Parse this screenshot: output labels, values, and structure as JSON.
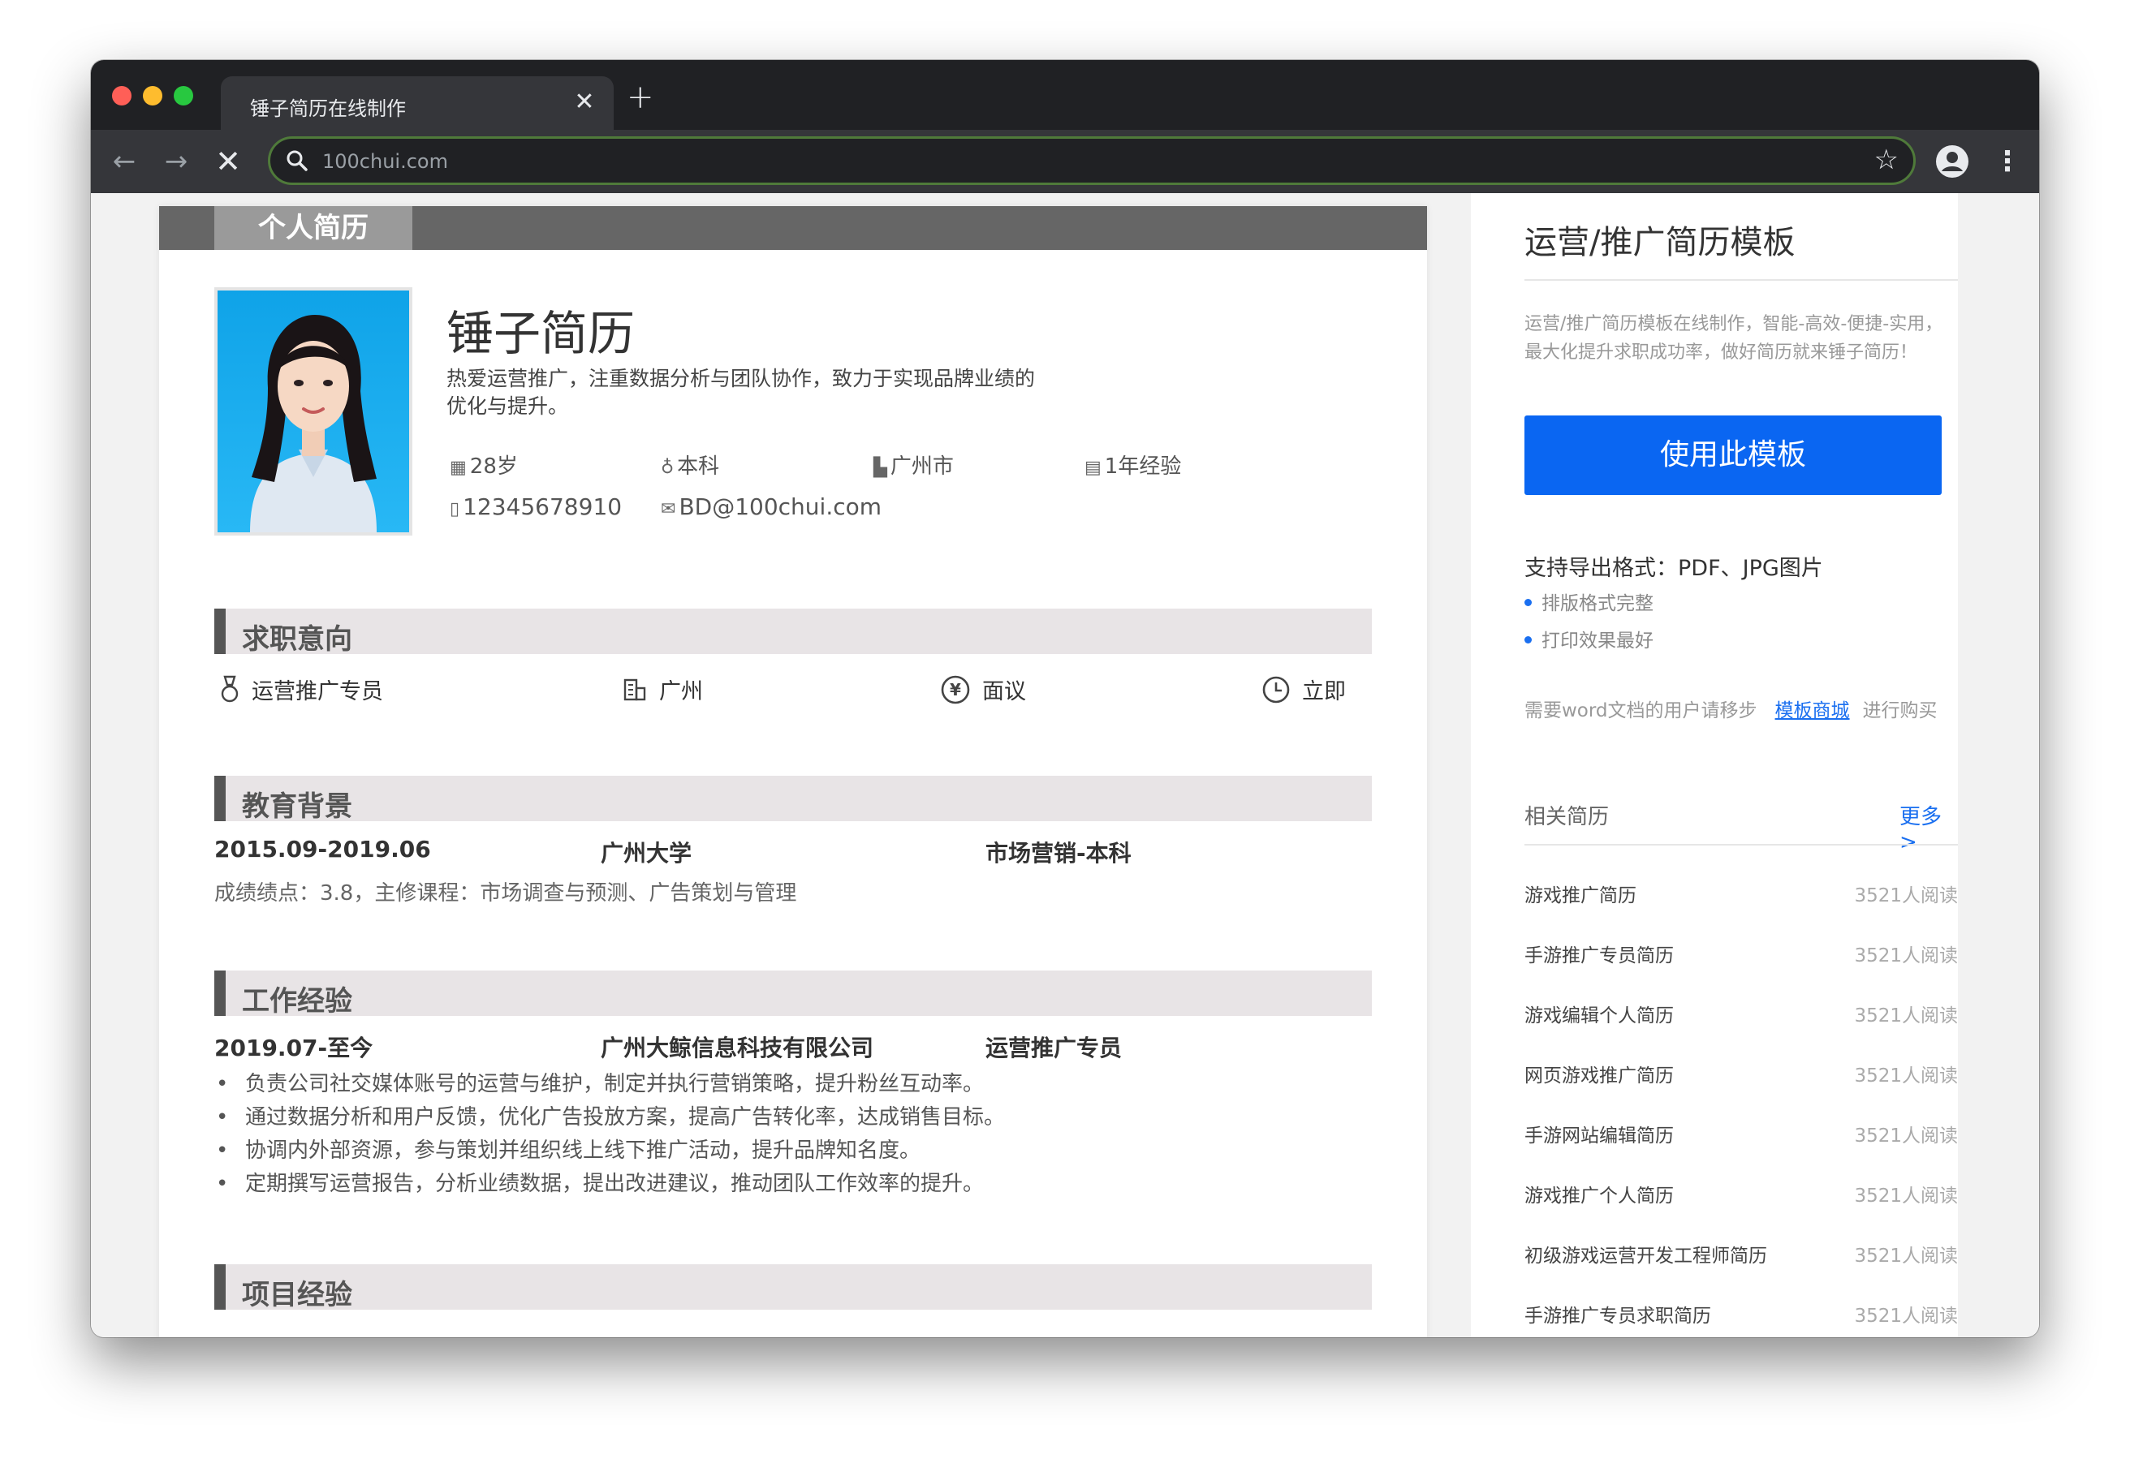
{
  "browser": {
    "tab_title": "锤子简历在线制作",
    "tab_close": "✕",
    "new_tab": "+",
    "url": "100chui.com",
    "back": "←",
    "forward": "→",
    "stop": "✕",
    "star": "☆",
    "menu": "⋮"
  },
  "resume": {
    "banner": "个人简历",
    "name": "锤子简历",
    "intro": "热爱运营推广，注重数据分析与团队协作，致力于实现品牌业绩的优化与提升。",
    "info": {
      "age": "28岁",
      "degree": "本科",
      "city": "广州市",
      "experience": "1年经验",
      "phone": "12345678910",
      "email": "BD@100chui.com"
    },
    "sections": {
      "intent": "求职意向",
      "education": "教育背景",
      "work": "工作经验",
      "project": "项目经验"
    },
    "intent": {
      "position": "运营推广专员",
      "city": "广州",
      "salary": "面议",
      "availability": "立即"
    },
    "education": {
      "period": "2015.09-2019.06",
      "school": "广州大学",
      "major": "市场营销-本科",
      "detail": "成绩绩点：3.8，主修课程：市场调查与预测、广告策划与管理"
    },
    "work": {
      "period": "2019.07-至今",
      "company": "广州大鲸信息科技有限公司",
      "role": "运营推广专员",
      "bullets": [
        "负责公司社交媒体账号的运营与维护，制定并执行营销策略，提升粉丝互动率。",
        "通过数据分析和用户反馈，优化广告投放方案，提高广告转化率，达成销售目标。",
        "协调内外部资源，参与策划并组织线上线下推广活动，提升品牌知名度。",
        "定期撰写运营报告，分析业绩数据，提出改进建议，推动团队工作效率的提升。"
      ]
    }
  },
  "sidebar": {
    "title": "运营/推广简历模板",
    "description": "运营/推广简历模板在线制作，智能-高效-便捷-实用，最大化提升求职成功率，做好简历就来锤子简历！",
    "use_button": "使用此模板",
    "export_title": "支持导出格式：PDF、JPG图片",
    "features": [
      "排版格式完整",
      "打印效果最好"
    ],
    "word_note_prefix": "需要word文档的用户请移步",
    "word_note_link": "模板商城",
    "word_note_suffix": "进行购买",
    "related_title": "相关简历",
    "more": "更多>",
    "related": [
      {
        "name": "游戏推广简历",
        "count": "3521人阅读"
      },
      {
        "name": "手游推广专员简历",
        "count": "3521人阅读"
      },
      {
        "name": "游戏编辑个人简历",
        "count": "3521人阅读"
      },
      {
        "name": "网页游戏推广简历",
        "count": "3521人阅读"
      },
      {
        "name": "手游网站编辑简历",
        "count": "3521人阅读"
      },
      {
        "name": "游戏推广个人简历",
        "count": "3521人阅读"
      },
      {
        "name": "初级游戏运营开发工程师简历",
        "count": "3521人阅读"
      },
      {
        "name": "手游推广专员求职简历",
        "count": "3521人阅读"
      }
    ]
  },
  "colors": {
    "accent_blue": "#0a66f2",
    "section_bar": "#e8e4e6",
    "chrome_dark": "#202124"
  }
}
